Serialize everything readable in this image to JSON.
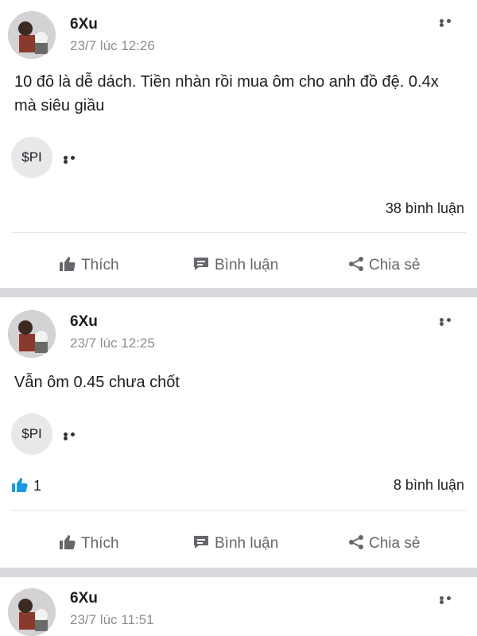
{
  "icons": {
    "more": "more-horizontal-icon",
    "like": "thumbs-up-icon",
    "comment": "comment-icon",
    "share": "share-icon",
    "like_count": "thumbs-up-filled-icon"
  },
  "colors": {
    "like_accent": "#1b9ae0",
    "separator": "#d9dadd",
    "secondary_text": "#8a8d91"
  },
  "actions": {
    "like": "Thích",
    "comment": "Bình luận",
    "share": "Chia sẻ"
  },
  "posts": [
    {
      "author": "6Xu",
      "time": "23/7 lúc 12:26",
      "text": "10 đô là dễ dách. Tiền nhàn rồi mua ôm cho anh đồ đệ. 0.4x mà siêu giầu",
      "tag": "$PI",
      "comments": "38 bình luận"
    },
    {
      "author": "6Xu",
      "time": "23/7 lúc 12:25",
      "text": "Vẫn ôm 0.45 chưa chốt",
      "tag": "$PI",
      "likes": "1",
      "comments": "8 bình luận"
    },
    {
      "author": "6Xu",
      "time": "23/7 lúc 11:51"
    }
  ]
}
